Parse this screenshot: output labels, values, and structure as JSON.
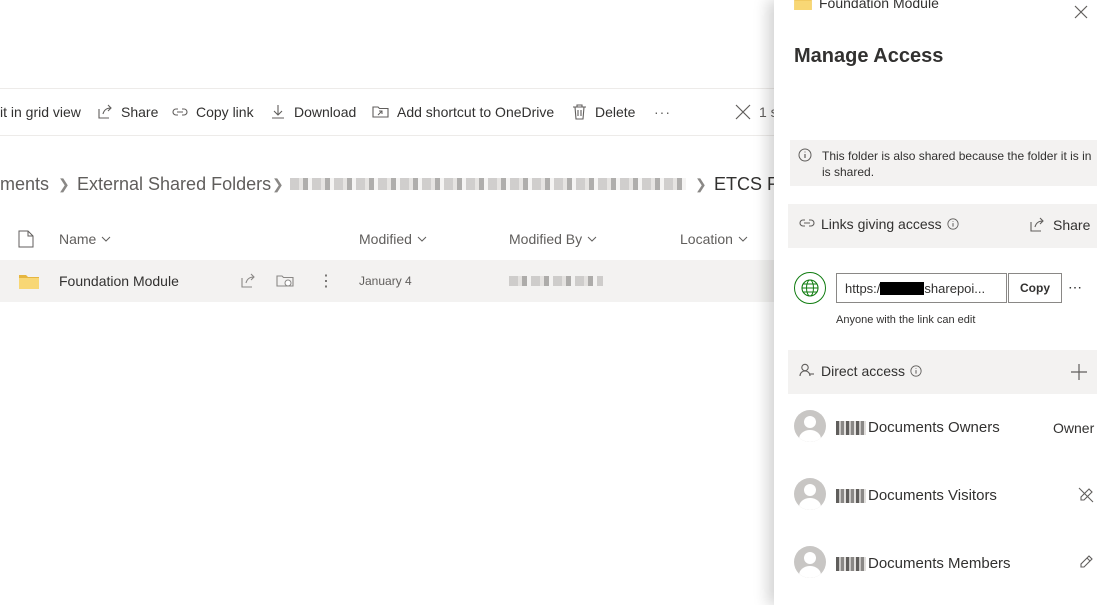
{
  "commandbar": {
    "edit_grid": "it in grid view",
    "share": "Share",
    "copy_link": "Copy link",
    "download": "Download",
    "add_shortcut": "Add shortcut to OneDrive",
    "delete": "Delete",
    "more": "···",
    "selection_partial": "1 s"
  },
  "breadcrumb": {
    "item0": "ments",
    "item1": "External Shared Folders",
    "item3": "ETCS Re"
  },
  "list": {
    "columns": {
      "name": "Name",
      "modified": "Modified",
      "modified_by": "Modified By",
      "location": "Location"
    },
    "rows": [
      {
        "name": "Foundation Module",
        "modified": "January 4"
      }
    ]
  },
  "panel": {
    "folder_name": "Foundation Module",
    "title": "Manage Access",
    "info_text": "This folder is also shared because the folder it is in is shared.",
    "links_title": "Links giving access",
    "share_label": "Share",
    "link_url_prefix": "https:/",
    "link_url_suffix": "sharepoi...",
    "copy_label": "Copy",
    "link_permission": "Anyone with the link can edit",
    "direct_title": "Direct access",
    "groups": [
      {
        "name": "Documents Owners",
        "role": "Owner"
      },
      {
        "name": "Documents Visitors"
      },
      {
        "name": "Documents Members"
      }
    ]
  },
  "colors": {
    "accent": "#0078d4",
    "folder": "#f8d775",
    "link_globe": "#107c10"
  }
}
